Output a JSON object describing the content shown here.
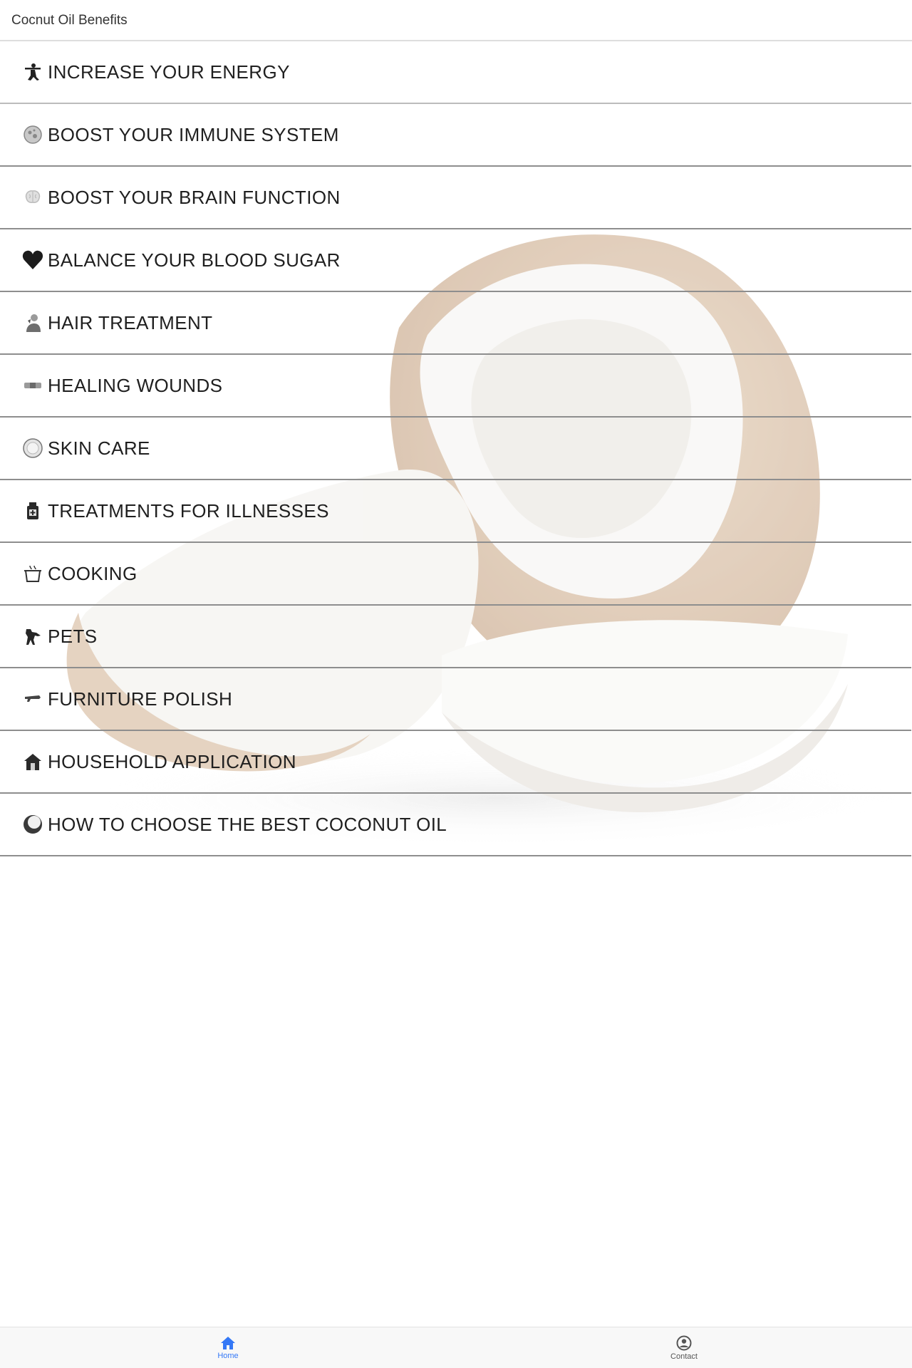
{
  "header": {
    "title": "Cocnut Oil Benefits"
  },
  "list": {
    "items": [
      {
        "label": "INCREASE YOUR ENERGY",
        "icon": "weightlifter-icon"
      },
      {
        "label": "BOOST YOUR IMMUNE SYSTEM",
        "icon": "microbe-icon"
      },
      {
        "label": "BOOST YOUR BRAIN FUNCTION",
        "icon": "brain-icon"
      },
      {
        "label": "BALANCE YOUR BLOOD SUGAR",
        "icon": "heart-icon"
      },
      {
        "label": "HAIR TREATMENT",
        "icon": "person-hair-icon"
      },
      {
        "label": "HEALING WOUNDS",
        "icon": "bandage-icon"
      },
      {
        "label": "SKIN CARE",
        "icon": "cream-jar-icon"
      },
      {
        "label": "TREATMENTS FOR ILLNESSES",
        "icon": "medicine-bottle-icon"
      },
      {
        "label": "COOKING",
        "icon": "cooking-pot-icon"
      },
      {
        "label": "PETS",
        "icon": "dog-icon"
      },
      {
        "label": "FURNITURE POLISH",
        "icon": "spray-icon"
      },
      {
        "label": "HOUSEHOLD APPLICATION",
        "icon": "house-icon"
      },
      {
        "label": "HOW TO CHOOSE THE BEST COCONUT OIL",
        "icon": "coconut-icon"
      }
    ]
  },
  "tabs": [
    {
      "label": "Home",
      "icon": "home-icon",
      "active": true
    },
    {
      "label": "Contact",
      "icon": "contact-icon",
      "active": false
    }
  ],
  "colors": {
    "active_tab": "#3478f6",
    "inactive_tab": "#555555",
    "text": "#1f1f1f",
    "divider": "#8e8e8e"
  }
}
